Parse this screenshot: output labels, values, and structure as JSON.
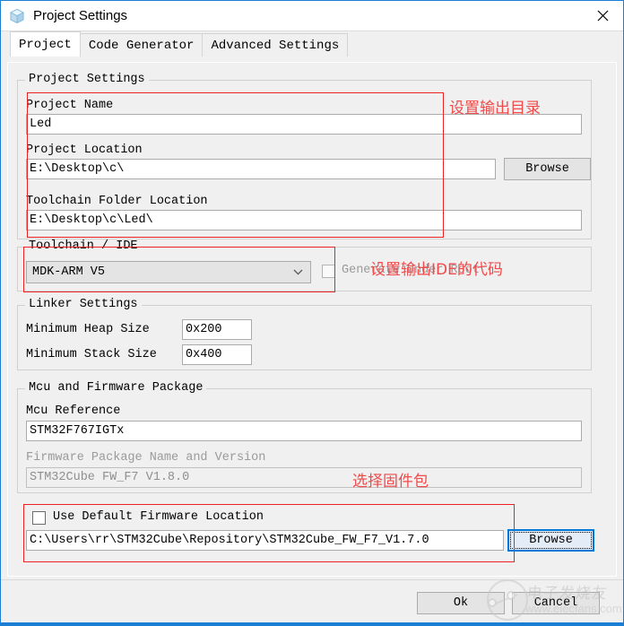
{
  "window": {
    "title": "Project Settings",
    "app_icon": "cube-icon",
    "close_icon": "close-icon",
    "accent_color": "#1a7fd4"
  },
  "tabs": [
    {
      "label": "Project",
      "active": true
    },
    {
      "label": "Code Generator",
      "active": false
    },
    {
      "label": "Advanced Settings",
      "active": false
    }
  ],
  "project_settings": {
    "group_title": "Project Settings",
    "project_name_label": "Project Name",
    "project_name_value": "Led",
    "project_location_label": "Project Location",
    "project_location_value": "E:\\Desktop\\c\\",
    "project_location_browse": "Browse",
    "toolchain_folder_label": "Toolchain Folder Location",
    "toolchain_folder_value": "E:\\Desktop\\c\\Led\\"
  },
  "toolchain": {
    "group_title": "Toolchain / IDE",
    "selected": "MDK-ARM V5",
    "options": [
      "MDK-ARM V5"
    ],
    "generate_under_root_label": "Generate Under Root",
    "generate_under_root_checked": false
  },
  "linker": {
    "group_title": "Linker Settings",
    "heap_label": "Minimum Heap Size",
    "heap_value": "0x200",
    "stack_label": "Minimum Stack Size",
    "stack_value": "0x400"
  },
  "mcu": {
    "group_title": "Mcu and Firmware Package",
    "reference_label": "Mcu Reference",
    "reference_value": "STM32F767IGTx",
    "firmware_label": "Firmware Package Name and Version",
    "firmware_value": "STM32Cube FW_F7 V1.8.0",
    "use_default_label": "Use Default Firmware Location",
    "use_default_checked": false,
    "firmware_path_value": "C:\\Users\\rr\\STM32Cube\\Repository\\STM32Cube_FW_F7_V1.7.0",
    "firmware_browse": "Browse"
  },
  "footer": {
    "ok_label": "Ok",
    "cancel_label": "Cancel"
  },
  "annotations": {
    "color": "#f04a4a",
    "note_output_dir": "设置输出目录",
    "note_output_ide": "设置输出IDE的代码",
    "note_firmware_pkg": "选择固件包"
  },
  "watermark": {
    "brand_cn": "电子发烧友",
    "url": "www.elecfans.com"
  }
}
